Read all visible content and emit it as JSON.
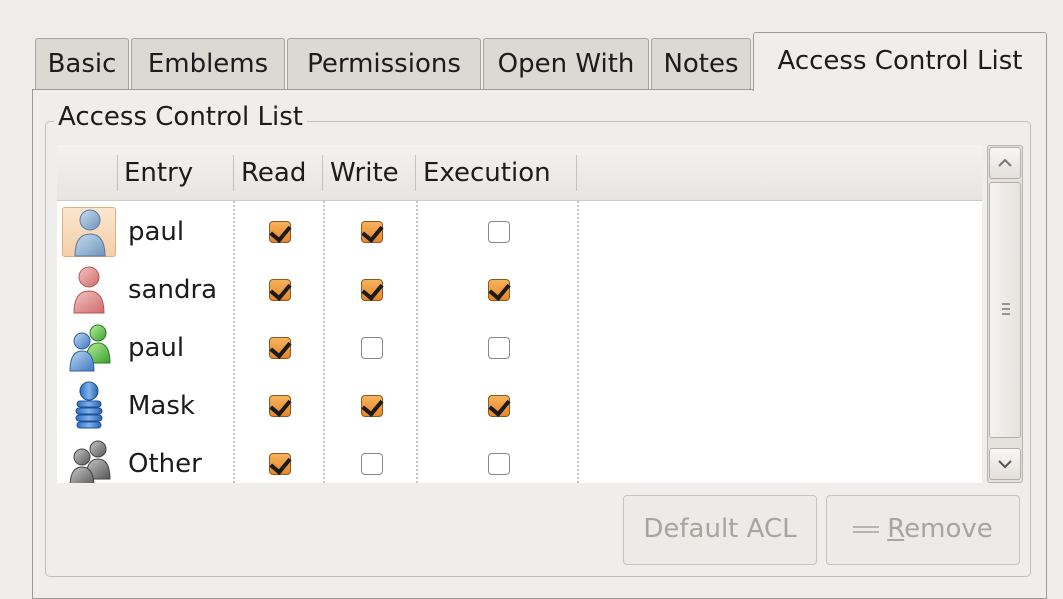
{
  "tabs": [
    {
      "label": "Basic",
      "active": false
    },
    {
      "label": "Emblems",
      "active": false
    },
    {
      "label": "Permissions",
      "active": false
    },
    {
      "label": "Open With",
      "active": false
    },
    {
      "label": "Notes",
      "active": false
    },
    {
      "label": "Access Control List",
      "active": true
    }
  ],
  "frame": {
    "title": "Access Control List"
  },
  "table": {
    "columns": {
      "entry": "Entry",
      "read": "Read",
      "write": "Write",
      "execution": "Execution"
    },
    "rows": [
      {
        "entry": "paul",
        "icon": "user-icon",
        "read": true,
        "write": true,
        "execution": false
      },
      {
        "entry": "sandra",
        "icon": "user-icon",
        "read": true,
        "write": true,
        "execution": true
      },
      {
        "entry": "paul",
        "icon": "group-icon",
        "read": true,
        "write": false,
        "execution": false
      },
      {
        "entry": "Mask",
        "icon": "mask-icon",
        "read": true,
        "write": true,
        "execution": true
      },
      {
        "entry": "Other",
        "icon": "other-icon",
        "read": true,
        "write": false,
        "execution": false
      }
    ]
  },
  "buttons": {
    "default_acl": "Default ACL",
    "remove_mnemonic": "R",
    "remove_rest": "emove"
  },
  "colors": {
    "accent": "#f0a040",
    "selection": "#f4cfa8"
  }
}
